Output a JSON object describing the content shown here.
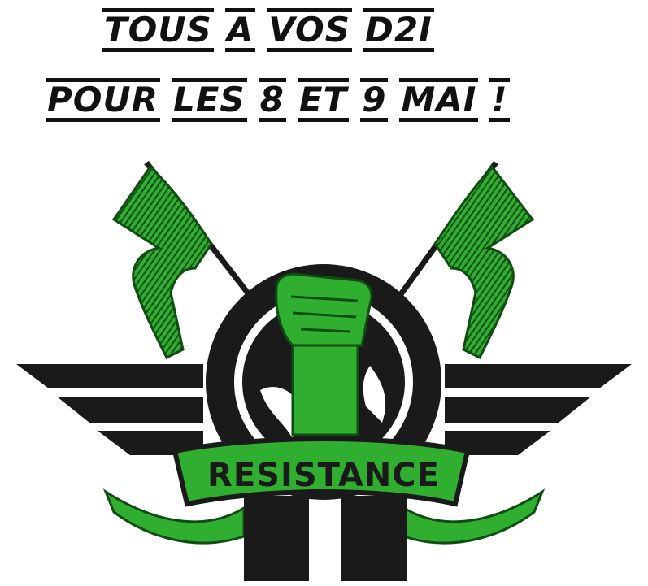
{
  "headline": {
    "line1": [
      "TOUS",
      "A",
      "VOS",
      "D2I"
    ],
    "line2": [
      "POUR",
      "LES",
      "8",
      "ET",
      "9",
      "MAI",
      "!"
    ]
  },
  "logo": {
    "banner_text": "RESISTANCE",
    "colors": {
      "green": "#2fae2f",
      "dark_green": "#0f4d12",
      "black": "#1a1a1a",
      "white": "#ffffff"
    }
  }
}
